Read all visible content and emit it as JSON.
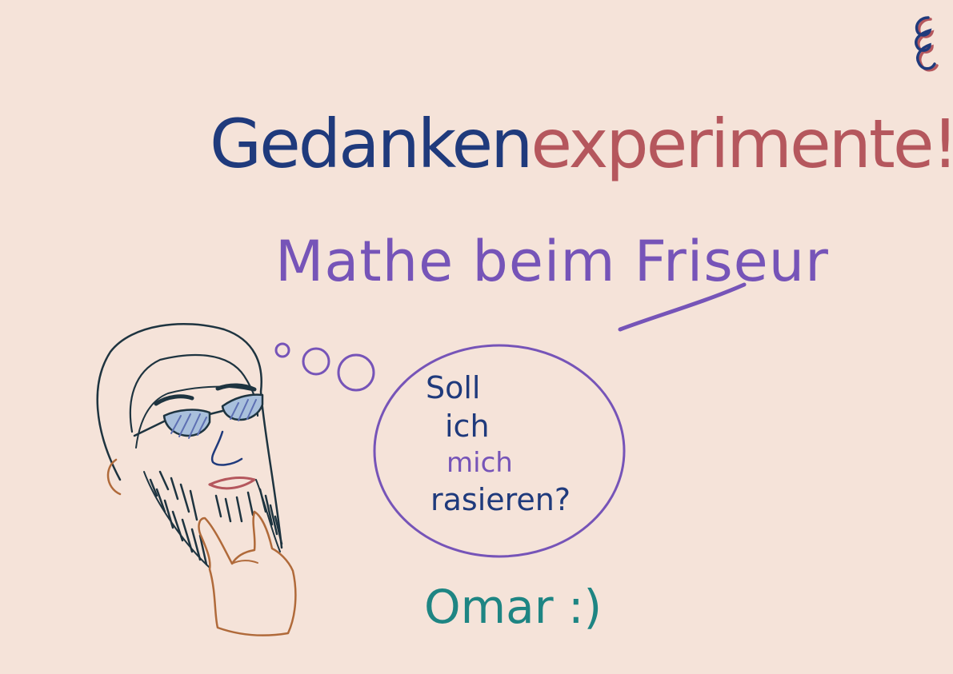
{
  "title": {
    "part1": "Gedanken",
    "part2": "experimente!"
  },
  "subtitle": "Mathe beim Friseur",
  "thought_bubble": {
    "line1": "Soll",
    "line2": "ich",
    "line3": "mich",
    "line4": "rasieren?"
  },
  "signature": "Omar :)",
  "colors": {
    "background": "#f5e3d9",
    "navy": "#1f3a7c",
    "red": "#b5575d",
    "purple": "#7654b8",
    "teal": "#1e8583",
    "skin": "#b06a3a",
    "outline": "#1e3440"
  }
}
